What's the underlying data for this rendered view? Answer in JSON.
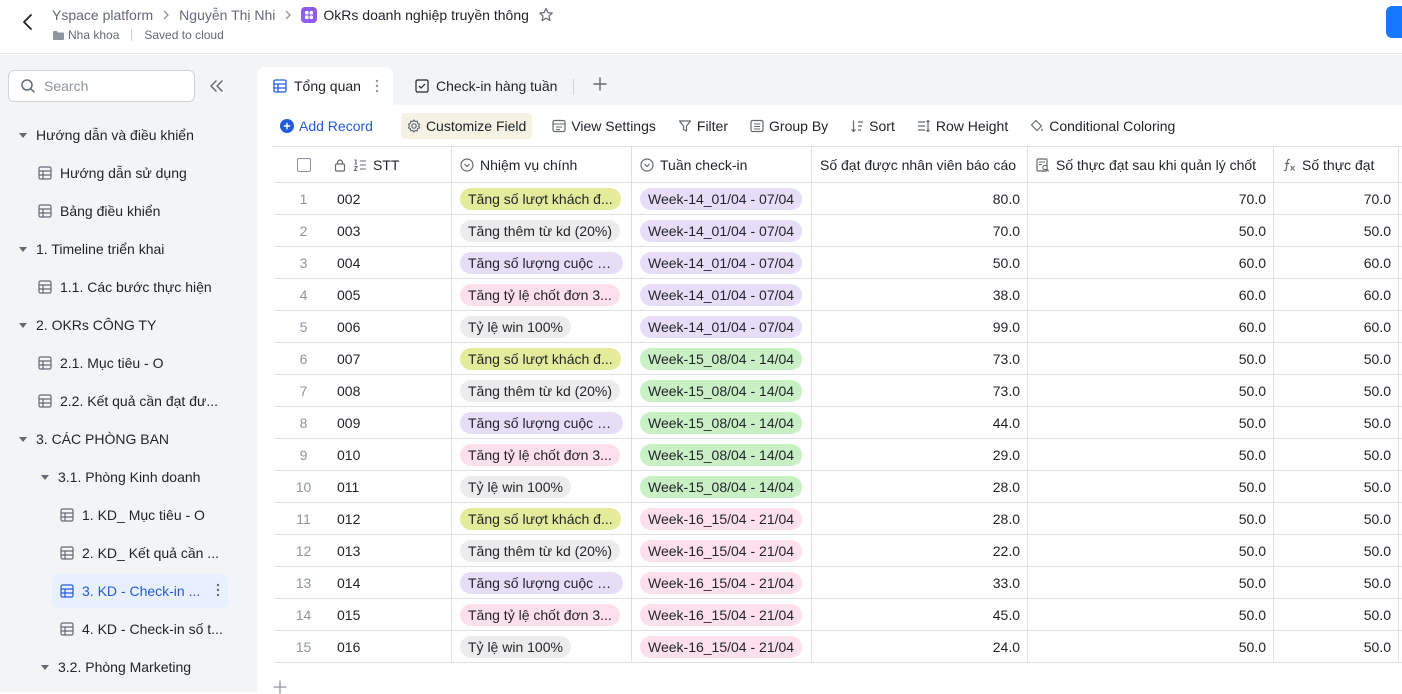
{
  "topbar": {
    "crumbs": [
      "Yspace platform",
      "Nguyễn Thị Nhi",
      "OkRs doanh nghiệp truyền thông"
    ],
    "folder": "Nha khoa",
    "save_status": "Saved to cloud"
  },
  "sidebar": {
    "search_placeholder": "Search",
    "items": [
      {
        "label": "Hướng dẫn và điều khiển"
      },
      {
        "label": "Hướng dẫn sử dụng"
      },
      {
        "label": "Bảng điều khiển"
      },
      {
        "label": "1. Timeline triển khai"
      },
      {
        "label": "1.1. Các bước thực hiện"
      },
      {
        "label": "2. OKRs CÔNG TY"
      },
      {
        "label": "2.1. Mục tiêu - O"
      },
      {
        "label": "2.2. Kết quả cần đạt đư..."
      },
      {
        "label": "3. CÁC PHÒNG BAN"
      },
      {
        "label": "3.1. Phòng Kinh doanh"
      },
      {
        "label": "1. KD_ Mục tiêu - O"
      },
      {
        "label": "2. KD_ Kết quả cần ..."
      },
      {
        "label": "3. KD - Check-in ..."
      },
      {
        "label": "4. KD - Check-in số t..."
      },
      {
        "label": "3.2. Phòng Marketing"
      }
    ]
  },
  "tabs": [
    {
      "label": "Tổng quan"
    },
    {
      "label": "Check-in hàng tuần"
    }
  ],
  "toolbar": {
    "add_record": "Add Record",
    "customize_field": "Customize Field",
    "view_settings": "View Settings",
    "filter": "Filter",
    "group_by": "Group By",
    "sort": "Sort",
    "row_height": "Row Height",
    "conditional_coloring": "Conditional Coloring"
  },
  "table": {
    "columns": [
      "STT",
      "Nhiệm vụ chính",
      "Tuần check-in",
      "Số đạt được nhân viên báo cáo",
      "Số thực đạt sau khi quản lý chốt",
      "Số thực đạt"
    ],
    "rows": [
      {
        "idx": "1",
        "stt": "002",
        "task": "Tăng số lượt khách đ...",
        "task_color": "#e3ec9a",
        "week": "Week-14_01/04 - 07/04",
        "week_color": "#e6def9",
        "reported": "80.0",
        "approved": "70.0",
        "actual": "70.0"
      },
      {
        "idx": "2",
        "stt": "003",
        "task": "Tăng thêm từ kd (20%)",
        "task_color": "#ececec",
        "week": "Week-14_01/04 - 07/04",
        "week_color": "#e6def9",
        "reported": "70.0",
        "approved": "50.0",
        "actual": "50.0"
      },
      {
        "idx": "3",
        "stt": "004",
        "task": "Tăng số lượng cuộc g...",
        "task_color": "#e6def9",
        "week": "Week-14_01/04 - 07/04",
        "week_color": "#e6def9",
        "reported": "50.0",
        "approved": "60.0",
        "actual": "60.0"
      },
      {
        "idx": "4",
        "stt": "005",
        "task": "Tăng tỷ lệ chốt đơn 3...",
        "task_color": "#fde0ec",
        "week": "Week-14_01/04 - 07/04",
        "week_color": "#e6def9",
        "reported": "38.0",
        "approved": "60.0",
        "actual": "60.0"
      },
      {
        "idx": "5",
        "stt": "006",
        "task": "Tỷ lệ win 100%",
        "task_color": "#ececec",
        "week": "Week-14_01/04 - 07/04",
        "week_color": "#e6def9",
        "reported": "99.0",
        "approved": "60.0",
        "actual": "60.0"
      },
      {
        "idx": "6",
        "stt": "007",
        "task": "Tăng số lượt khách đ...",
        "task_color": "#e3ec9a",
        "week": "Week-15_08/04 - 14/04",
        "week_color": "#c9efc4",
        "reported": "73.0",
        "approved": "50.0",
        "actual": "50.0"
      },
      {
        "idx": "7",
        "stt": "008",
        "task": "Tăng thêm từ kd (20%)",
        "task_color": "#ececec",
        "week": "Week-15_08/04 - 14/04",
        "week_color": "#c9efc4",
        "reported": "73.0",
        "approved": "50.0",
        "actual": "50.0"
      },
      {
        "idx": "8",
        "stt": "009",
        "task": "Tăng số lượng cuộc g...",
        "task_color": "#e6def9",
        "week": "Week-15_08/04 - 14/04",
        "week_color": "#c9efc4",
        "reported": "44.0",
        "approved": "50.0",
        "actual": "50.0"
      },
      {
        "idx": "9",
        "stt": "010",
        "task": "Tăng tỷ lệ chốt đơn 3...",
        "task_color": "#fde0ec",
        "week": "Week-15_08/04 - 14/04",
        "week_color": "#c9efc4",
        "reported": "29.0",
        "approved": "50.0",
        "actual": "50.0"
      },
      {
        "idx": "10",
        "stt": "011",
        "task": "Tỷ lệ win 100%",
        "task_color": "#ececec",
        "week": "Week-15_08/04 - 14/04",
        "week_color": "#c9efc4",
        "reported": "28.0",
        "approved": "50.0",
        "actual": "50.0"
      },
      {
        "idx": "11",
        "stt": "012",
        "task": "Tăng số lượt khách đ...",
        "task_color": "#e3ec9a",
        "week": "Week-16_15/04 - 21/04",
        "week_color": "#fde0ec",
        "reported": "28.0",
        "approved": "50.0",
        "actual": "50.0"
      },
      {
        "idx": "12",
        "stt": "013",
        "task": "Tăng thêm từ kd (20%)",
        "task_color": "#ececec",
        "week": "Week-16_15/04 - 21/04",
        "week_color": "#fde0ec",
        "reported": "22.0",
        "approved": "50.0",
        "actual": "50.0"
      },
      {
        "idx": "13",
        "stt": "014",
        "task": "Tăng số lượng cuộc g...",
        "task_color": "#e6def9",
        "week": "Week-16_15/04 - 21/04",
        "week_color": "#fde0ec",
        "reported": "33.0",
        "approved": "50.0",
        "actual": "50.0"
      },
      {
        "idx": "14",
        "stt": "015",
        "task": "Tăng tỷ lệ chốt đơn 3...",
        "task_color": "#fde0ec",
        "week": "Week-16_15/04 - 21/04",
        "week_color": "#fde0ec",
        "reported": "45.0",
        "approved": "50.0",
        "actual": "50.0"
      },
      {
        "idx": "15",
        "stt": "016",
        "task": "Tỷ lệ win 100%",
        "task_color": "#ececec",
        "week": "Week-16_15/04 - 21/04",
        "week_color": "#fde0ec",
        "reported": "24.0",
        "approved": "50.0",
        "actual": "50.0"
      }
    ]
  }
}
